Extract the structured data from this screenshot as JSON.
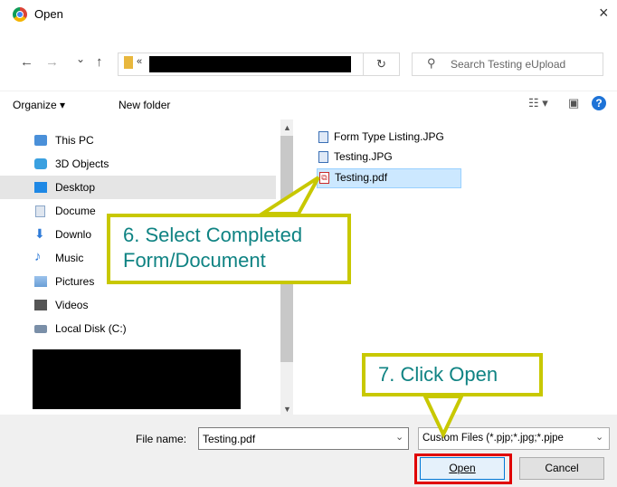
{
  "window": {
    "title": "Open",
    "close_glyph": "×"
  },
  "nav": {
    "back_glyph": "←",
    "forward_glyph": "→",
    "recent_glyph": "⌄",
    "up_glyph": "↑",
    "path_chevron": "«",
    "refresh_glyph": "↻",
    "search_placeholder": "Search Testing eUpload"
  },
  "toolbar": {
    "organize_label": "Organize ▾",
    "new_folder_label": "New folder",
    "view_glyph": "☷ ▾",
    "pane_glyph": "▣",
    "help_glyph": "?"
  },
  "tree": {
    "items": [
      {
        "label": "This PC",
        "icon": "pc-icon",
        "color": "#4a90d9"
      },
      {
        "label": "3D Objects",
        "icon": "3d-objects-icon",
        "color": "#3aa0e0"
      },
      {
        "label": "Desktop",
        "icon": "desktop-icon",
        "color": "#1e88e5"
      },
      {
        "label": "Docume",
        "icon": "documents-icon",
        "color": "#8aa6c8"
      },
      {
        "label": "Downlo",
        "icon": "downloads-icon",
        "color": "#2f7bd8"
      },
      {
        "label": "Music",
        "icon": "music-icon",
        "color": "#2f7bd8"
      },
      {
        "label": "Pictures",
        "icon": "pictures-icon",
        "color": "#6a9ed6"
      },
      {
        "label": "Videos",
        "icon": "videos-icon",
        "color": "#555555"
      },
      {
        "label": "Local Disk (C:)",
        "icon": "disk-icon",
        "color": "#7a8fa8"
      }
    ],
    "selected_index": 2
  },
  "files": [
    {
      "name": "Form Type Listing.JPG",
      "type": "jpg"
    },
    {
      "name": "Testing.JPG",
      "type": "jpg"
    },
    {
      "name": "Testing.pdf",
      "type": "pdf",
      "selected": true
    }
  ],
  "bottom": {
    "filename_label": "File name:",
    "filename_value": "Testing.pdf",
    "filetype_value": "Custom Files (*.pjp;*.jpg;*.pjpe",
    "open_label": "Open",
    "cancel_label": "Cancel"
  },
  "annotations": {
    "step6": "6. Select Completed Form/Document",
    "step7": "7. Click Open",
    "callout_color": "#c8c800",
    "callout_text_color": "#0f8383",
    "highlight_color": "#e00000"
  }
}
